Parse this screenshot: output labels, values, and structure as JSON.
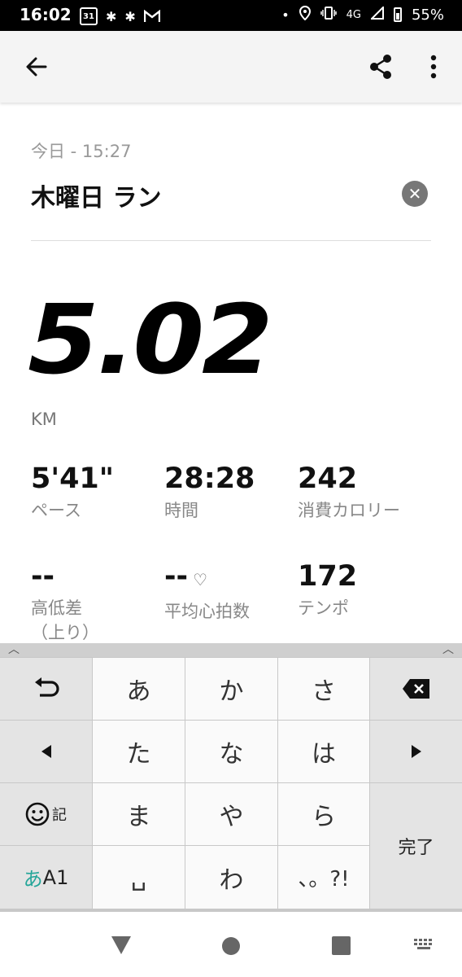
{
  "status_bar": {
    "time": "16:02",
    "calendar_day": "31",
    "network": "4G",
    "battery": "55%"
  },
  "app_bar": {
    "back_icon": "arrow-left-icon",
    "share_icon": "share-icon",
    "more_icon": "more-vertical-icon"
  },
  "activity": {
    "date": "今日 - 15:27",
    "title": "木曜日 ラン",
    "distance": "5.02",
    "distance_unit": "KM"
  },
  "stats": [
    {
      "value": "5'41\"",
      "label": "ペース"
    },
    {
      "value": "28:28",
      "label": "時間"
    },
    {
      "value": "242",
      "label": "消費カロリー"
    },
    {
      "value": "--",
      "label": "高低差\n（上り）"
    },
    {
      "value": "--",
      "label": "平均心拍数"
    },
    {
      "value": "172",
      "label": "テンポ"
    }
  ],
  "keyboard": {
    "row1": [
      "あ",
      "か",
      "さ"
    ],
    "row2": [
      "た",
      "な",
      "は"
    ],
    "row3": [
      "ま",
      "や",
      "ら"
    ],
    "row4": [
      "わ",
      "、。?!"
    ],
    "emoji_label": "記",
    "mode_kana": "あ",
    "mode_alpha": "A1",
    "done": "完了",
    "space_symbol": "␣"
  },
  "colors": {
    "accent_teal": "#26a69a",
    "key_bg": "#fafafa",
    "fn_key_bg": "#e4e4e4"
  }
}
